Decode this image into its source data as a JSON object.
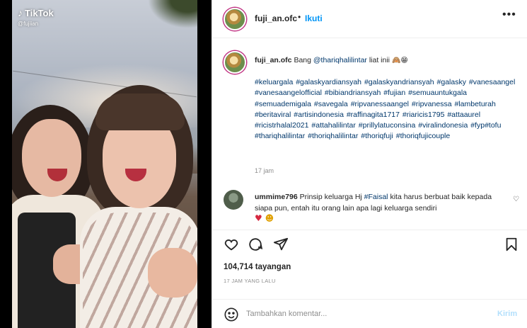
{
  "media": {
    "watermark_brand": "TikTok",
    "watermark_handle": "@fujiian"
  },
  "header": {
    "username": "fuji_an.ofc",
    "separator": "•",
    "follow_label": "Ikuti",
    "more_icon": "more-horizontal-icon"
  },
  "caption": {
    "username": "fuji_an.ofc",
    "text_prefix": "Bang ",
    "mention": "@thariqhalilintar",
    "text_suffix": " liat inii",
    "emojis": "🙈😁",
    "hashtags": [
      "#keluargala",
      "#galaskyardiansyah",
      "#galaskyandriansyah",
      "#galasky",
      "#vanesaangel",
      "#vanesaangelofficial",
      "#bibiandriansyah",
      "#fujian",
      "#semuauntukgala",
      "#semuademigala",
      "#savegala",
      "#ripvanessaangel",
      "#ripvanessa",
      "#lambeturah",
      "#beritaviral",
      "#artisindonesia",
      "#raffinagita1717",
      "#riaricis1795",
      "#attaaurel",
      "#ricistrhalal2021",
      "#attahalilintar",
      "#prillylatuconsina",
      "#viralindonesia",
      "#fyp#tofu",
      "#thariqhalilintar",
      "#thoriqhalilintar",
      "#thoriqfuji",
      "#thoriqfujicouple"
    ],
    "time": "17 jam"
  },
  "comment": {
    "username": "ummime796",
    "text_before": " Prinsip keluarga Hj ",
    "hashtag": "#Faisal",
    "text_after": " kita harus berbuat baik kepada siapa pun, entah itu orang lain apa lagi keluarga sendiri",
    "emoji_heart": "♥",
    "emoji_face": "☻",
    "like_icon": "heart-outline-icon"
  },
  "actions": {
    "icons": [
      "heart-icon",
      "comment-icon",
      "share-icon",
      "save-icon"
    ]
  },
  "stats": {
    "views": "104,714 tayangan",
    "posted": "17 JAM YANG LALU"
  },
  "add_comment": {
    "placeholder": "Tambahkan komentar...",
    "post_label": "Kirim"
  },
  "colors": {
    "link": "#00376b",
    "follow": "#0095f6",
    "post_disabled": "#b2dffc",
    "meta": "#8e8e8e"
  }
}
